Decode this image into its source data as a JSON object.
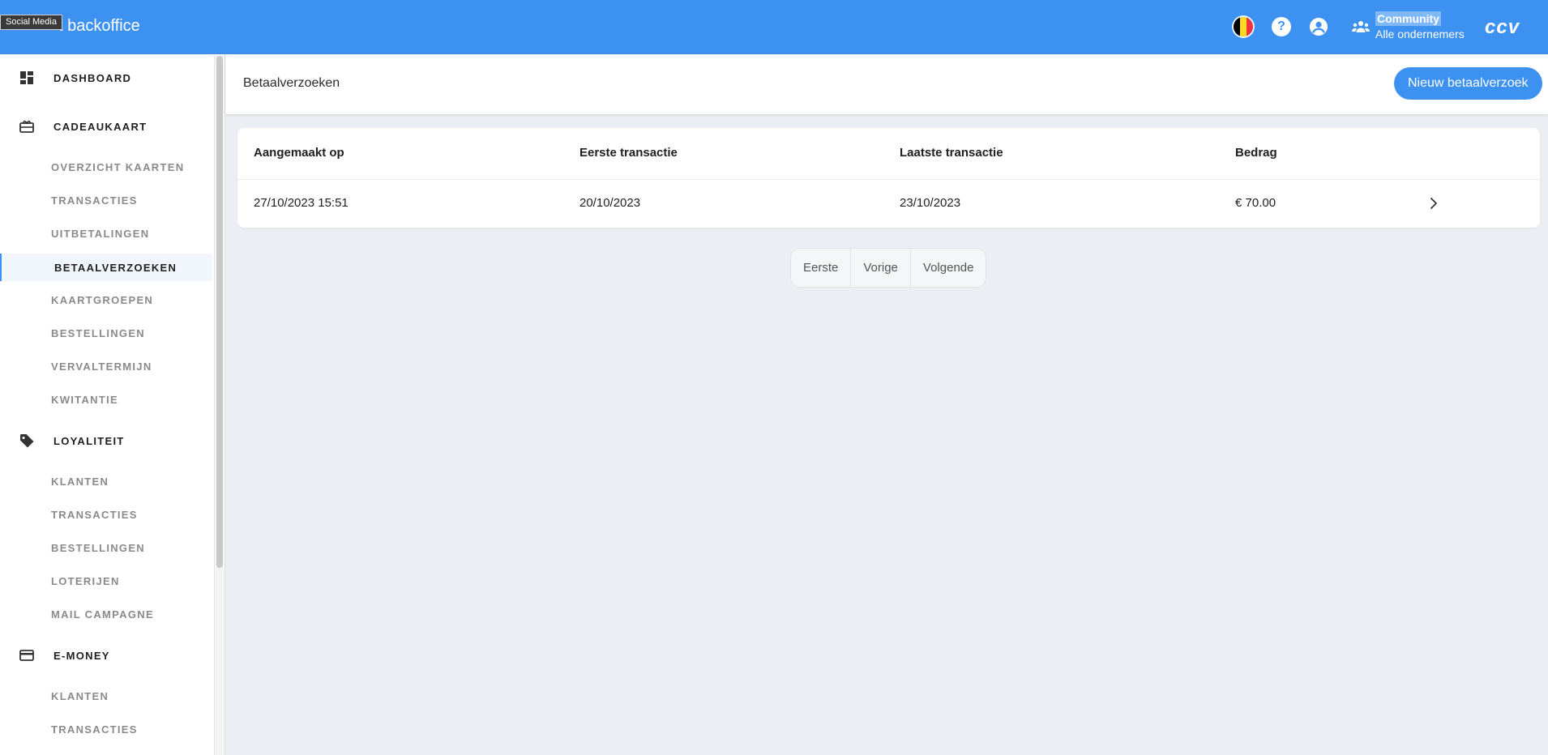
{
  "topbar": {
    "brand": "t backoffice",
    "tooltip": "Social Media",
    "community_title": "Community",
    "community_sub": "Alle ondernemers",
    "logo": "ccv",
    "help_glyph": "?",
    "flag_colors": [
      "#000000",
      "#fdda24",
      "#ef3340"
    ]
  },
  "sidebar": {
    "sections": [
      {
        "label": "DASHBOARD",
        "icon": "dashboard-icon"
      },
      {
        "label": "CADEAUKAART",
        "icon": "gift-card-icon"
      },
      {
        "label": "LOYALITEIT",
        "icon": "tag-icon"
      },
      {
        "label": "E-MONEY",
        "icon": "credit-card-icon"
      }
    ],
    "cadeaukaart_items": [
      "OVERZICHT KAARTEN",
      "TRANSACTIES",
      "UITBETALINGEN",
      "BETAALVERZOEKEN",
      "KAARTGROEPEN",
      "BESTELLINGEN",
      "VERVALTERMIJN",
      "KWITANTIE"
    ],
    "loyaliteit_items": [
      "KLANTEN",
      "TRANSACTIES",
      "BESTELLINGEN",
      "LOTERIJEN",
      "MAIL CAMPAGNE"
    ],
    "emoney_items": [
      "KLANTEN",
      "TRANSACTIES"
    ],
    "active_item": "BETAALVERZOEKEN"
  },
  "page": {
    "title": "Betaalverzoeken",
    "new_button": "Nieuw betaalverzoek"
  },
  "table": {
    "columns": [
      "Aangemaakt op",
      "Eerste transactie",
      "Laatste transactie",
      "Bedrag"
    ],
    "rows": [
      [
        "27/10/2023 15:51",
        "20/10/2023",
        "23/10/2023",
        "€ 70.00"
      ]
    ]
  },
  "pagination": {
    "first": "Eerste",
    "prev": "Vorige",
    "next": "Volgende"
  },
  "colors": {
    "accent": "#3d91f0",
    "background": "#ebeff3"
  }
}
